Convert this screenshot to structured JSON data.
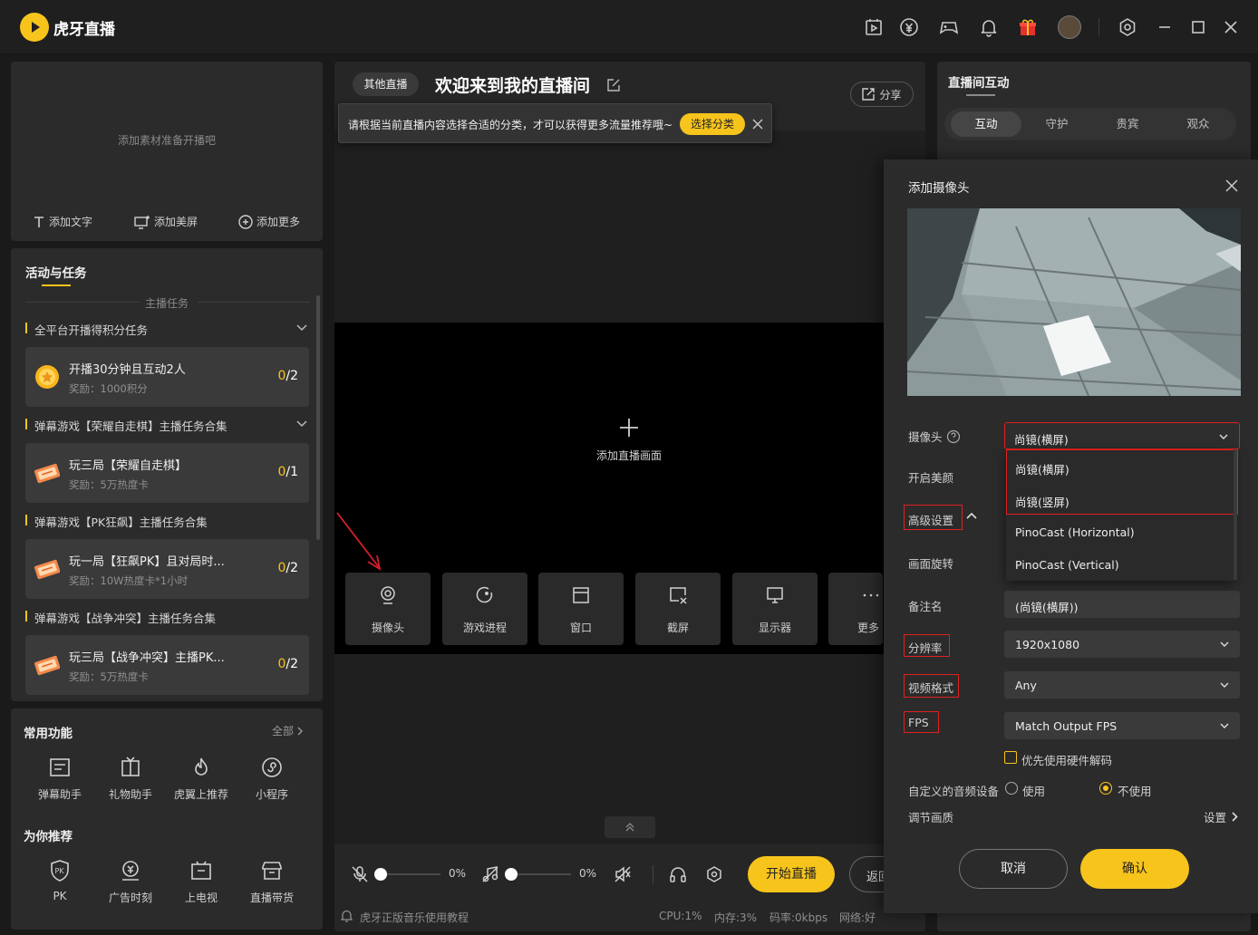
{
  "app": {
    "name": "虎牙直播"
  },
  "scene_panel": {
    "empty_hint": "添加素材准备开播吧",
    "actions": [
      {
        "label": "添加文字",
        "icon": "text-icon"
      },
      {
        "label": "添加美屏",
        "icon": "monitor-add-icon"
      },
      {
        "label": "添加更多",
        "icon": "plus-circle-icon"
      }
    ]
  },
  "tasks": {
    "title": "活动与任务",
    "subtitle": "主播任务",
    "groups": [
      {
        "title": "全平台开播得积分任务",
        "collapsible": true,
        "task": {
          "title": "开播30分钟且互动2人",
          "reward": "奖励：1000积分",
          "done": "0",
          "total": "/2",
          "icon": "coin-icon"
        }
      },
      {
        "title": "弹幕游戏【荣耀自走棋】主播任务合集",
        "collapsible": true,
        "task": {
          "title": "玩三局【荣耀自走棋】",
          "reward": "奖励：5万热度卡",
          "done": "0",
          "total": "/1",
          "icon": "ticket-icon"
        }
      },
      {
        "title": "弹幕游戏【PK狂飙】主播任务合集",
        "collapsible": false,
        "task": {
          "title": "玩一局【狂飙PK】且对局时...",
          "reward": "奖励：10W热度卡*1小时",
          "done": "0",
          "total": "/2",
          "icon": "ticket-icon"
        }
      },
      {
        "title": "弹幕游戏【战争冲突】主播任务合集",
        "collapsible": false,
        "task": {
          "title": "玩三局【战争冲突】主播PK...",
          "reward": "奖励：5万热度卡",
          "done": "0",
          "total": "/2",
          "icon": "ticket-icon"
        }
      }
    ]
  },
  "functions": {
    "title": "常用功能",
    "all_label": "全部",
    "items": [
      {
        "label": "弹幕助手",
        "icon": "barrage-icon"
      },
      {
        "label": "礼物助手",
        "icon": "gift-icon"
      },
      {
        "label": "虎翼上推荐",
        "icon": "flame-icon"
      },
      {
        "label": "小程序",
        "icon": "mini-program-icon"
      }
    ],
    "recommend_title": "为你推荐",
    "recommend": [
      {
        "label": "PK",
        "icon": "pk-shield-icon"
      },
      {
        "label": "广告时刻",
        "icon": "ad-icon"
      },
      {
        "label": "上电视",
        "icon": "tv-icon"
      },
      {
        "label": "直播带货",
        "icon": "shop-icon"
      }
    ]
  },
  "stream": {
    "category_badge": "其他直播",
    "title": "欢迎来到我的直播间",
    "share_label": "分享",
    "tooltip": {
      "text": "请根据当前直播内容选择合适的分类，才可以获得更多流量推荐哦~",
      "button": "选择分类"
    },
    "add_canvas_label": "添加直播画面",
    "sources": [
      {
        "label": "摄像头",
        "icon": "camera-icon"
      },
      {
        "label": "游戏进程",
        "icon": "game-process-icon"
      },
      {
        "label": "窗口",
        "icon": "window-icon"
      },
      {
        "label": "截屏",
        "icon": "screenshot-icon"
      },
      {
        "label": "显示器",
        "icon": "display-icon"
      },
      {
        "label": "更多",
        "icon": "more-icon"
      }
    ],
    "mic_volume": "0%",
    "music_volume": "0%",
    "start_label": "开始直播",
    "back_label": "返回"
  },
  "status_bar": {
    "music_tutorial": "虎牙正版音乐使用教程",
    "cpu": "CPU:1%",
    "memory": "内存:3%",
    "bitrate": "码率:0kbps",
    "network": "网络:好"
  },
  "interaction": {
    "title": "直播间互动",
    "tabs": [
      "互动",
      "守护",
      "贵宾",
      "观众"
    ],
    "active_tab": 0
  },
  "camera_dialog": {
    "title": "添加摄像头",
    "camera_label": "摄像头",
    "camera_value": "尚镜(横屏)",
    "camera_options": [
      "尚镜(横屏)",
      "尚镜(竖屏)",
      "PinoCast (Horizontal)",
      "PinoCast (Vertical)"
    ],
    "beauty_label": "开启美颜",
    "advanced_label": "高级设置",
    "rotate_label": "画面旋转",
    "alias_label": "备注名",
    "alias_value": "(尚镜(横屏))",
    "resolution_label": "分辨率",
    "resolution_value": "1920x1080",
    "format_label": "视频格式",
    "format_value": "Any",
    "fps_label": "FPS",
    "fps_value": "Match Output FPS",
    "hw_decode_label": "优先使用硬件解码",
    "audio_label": "自定义的音频设备",
    "audio_use": "使用",
    "audio_not_use": "不使用",
    "audio_selected": "不使用",
    "quality_label": "调节画质",
    "quality_settings": "设置",
    "cancel": "取消",
    "confirm": "确认"
  },
  "colors": {
    "accent": "#f7c41c",
    "highlight": "#e02020"
  }
}
